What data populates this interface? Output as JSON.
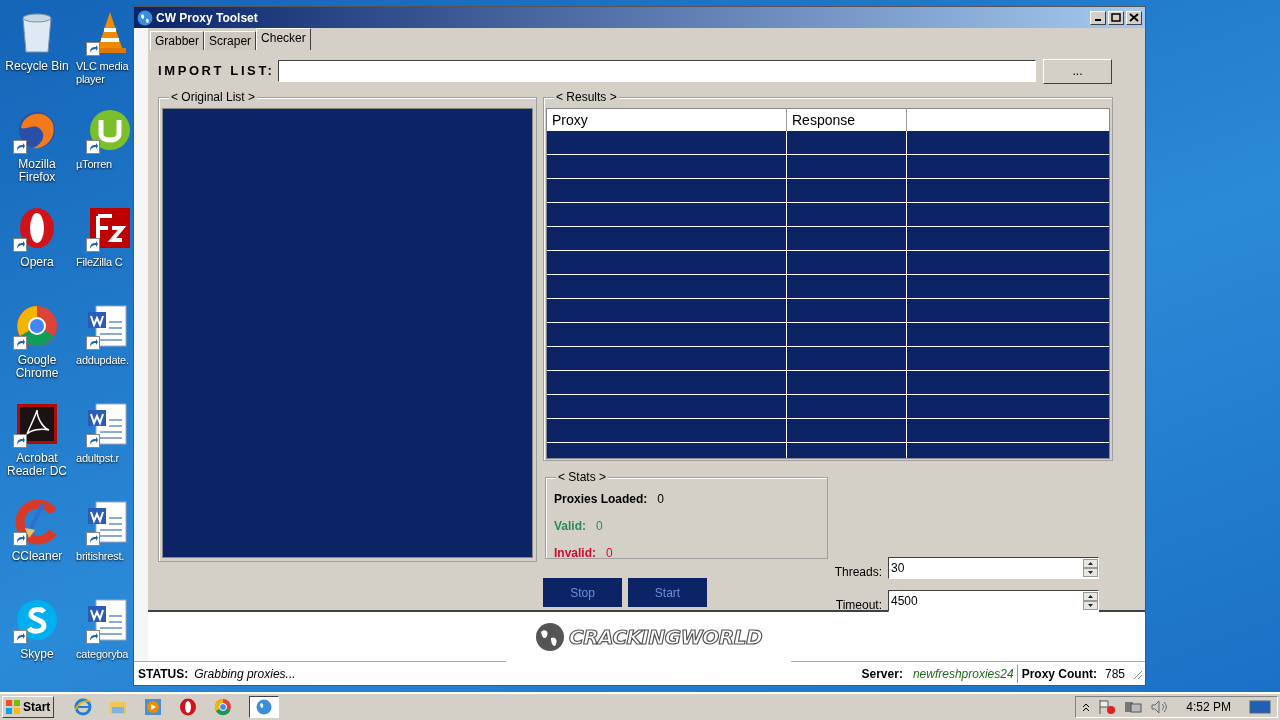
{
  "desktop": {
    "icons": [
      {
        "label": "Recycle Bin"
      },
      {
        "label": "VLC media player"
      },
      {
        "label": "Mozilla Firefox"
      },
      {
        "label": "µTorren"
      },
      {
        "label": "Opera"
      },
      {
        "label": "FileZilla C"
      },
      {
        "label": "Google Chrome"
      },
      {
        "label": "addupdate."
      },
      {
        "label": "Acrobat Reader DC"
      },
      {
        "label": "adultpst.r"
      },
      {
        "label": "CCleaner"
      },
      {
        "label": "britishrest."
      },
      {
        "label": "Skype"
      },
      {
        "label": "categoryba"
      }
    ]
  },
  "window": {
    "title": "CW Proxy Toolset",
    "tabs": [
      {
        "label": "Grabber",
        "selected": false
      },
      {
        "label": "Scraper",
        "selected": false
      },
      {
        "label": "Checker",
        "selected": true
      }
    ],
    "import": {
      "label": "IMPORT LIST:",
      "browse": "..."
    },
    "original_list": {
      "title": "< Original List >"
    },
    "results": {
      "title": "< Results >",
      "columns": [
        "Proxy",
        "Response"
      ]
    },
    "stats": {
      "title": "< Stats >",
      "items": [
        {
          "kind": "total",
          "label": "Proxies Loaded:",
          "value": "0"
        },
        {
          "kind": "valid",
          "label": "Valid:",
          "value": "0"
        },
        {
          "kind": "invalid",
          "label": "Invalid:",
          "value": "0"
        }
      ]
    },
    "buttons": [
      {
        "label": "Stop"
      },
      {
        "label": "Start"
      }
    ],
    "settings": [
      {
        "label": "Threads:",
        "value": "30"
      },
      {
        "label": "Timeout:",
        "value": "4500"
      }
    ],
    "logo": {
      "text": "CRACKINGWORLD"
    },
    "status_bar": {
      "label": "STATUS:",
      "message": "Grabbing proxies...",
      "server_label": "Server:",
      "server": "newfreshproxies24",
      "count_label": "Proxy Count:",
      "count": "785"
    }
  },
  "taskbar": {
    "start": "Start",
    "clock": "4:52 PM"
  }
}
